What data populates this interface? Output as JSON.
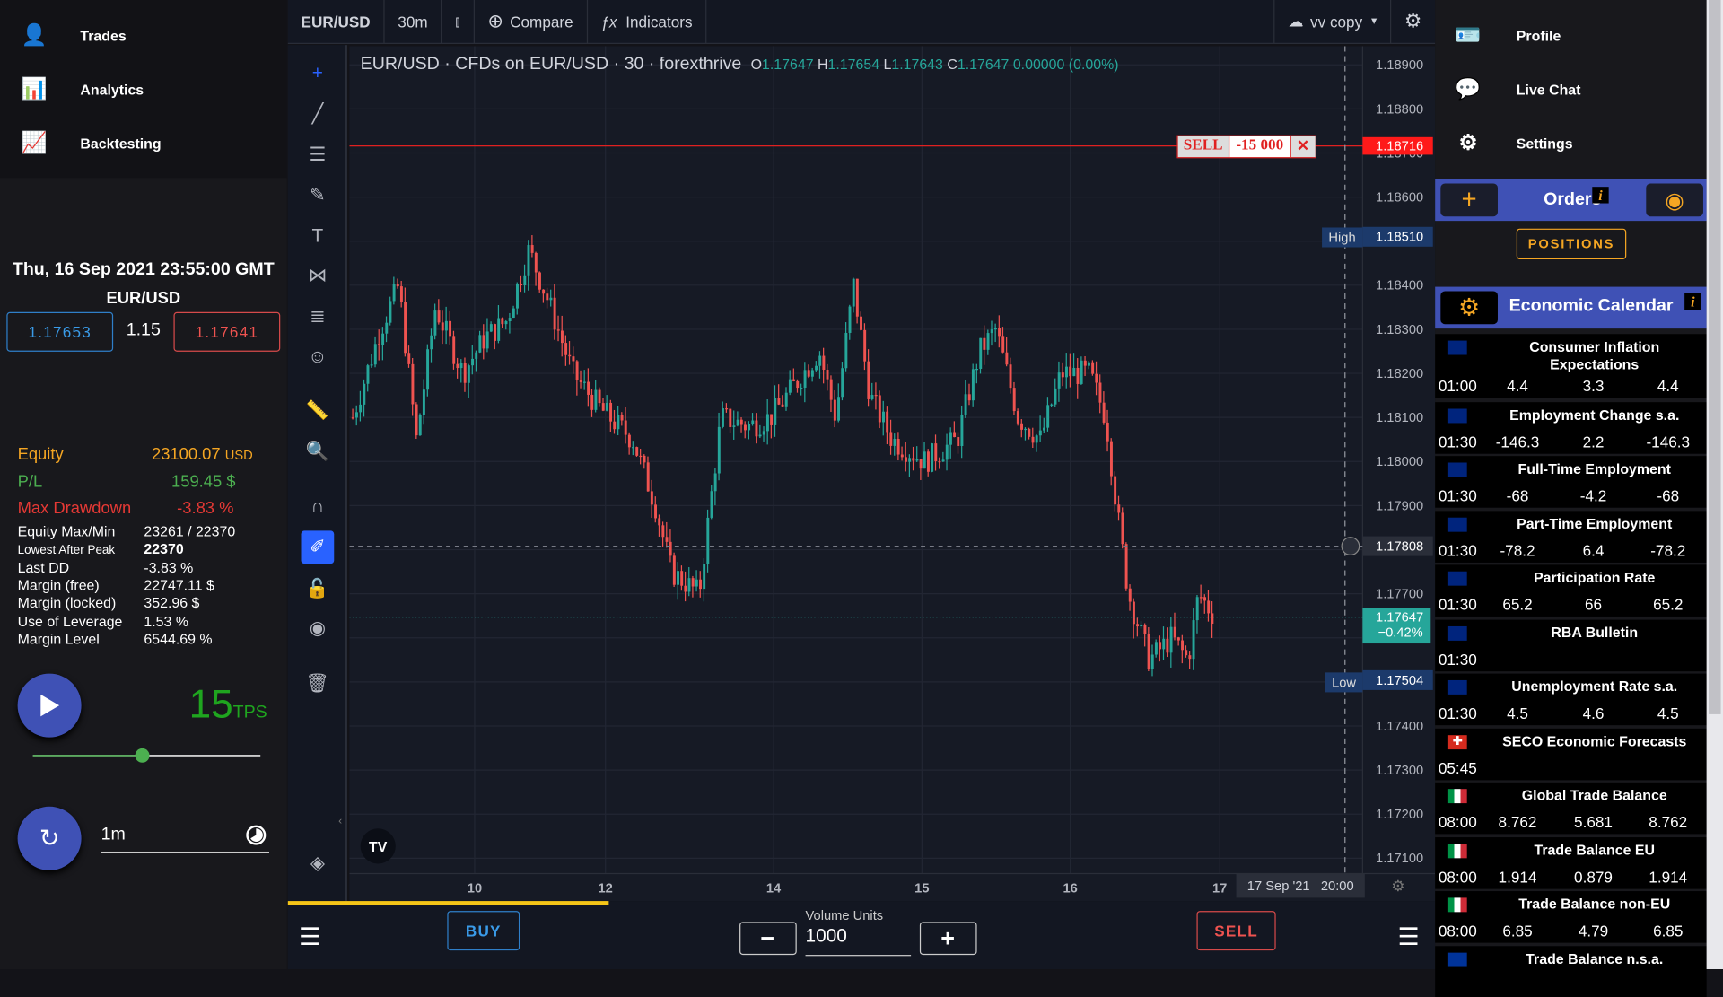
{
  "nav_left": [
    {
      "label": "Trades",
      "icon": "user-trades-icon"
    },
    {
      "label": "Analytics",
      "icon": "analytics-icon"
    },
    {
      "label": "Backtesting",
      "icon": "backtesting-icon"
    }
  ],
  "session": {
    "datetime": "Thu, 16 Sep 2021 23:55:00 GMT",
    "symbol": "EUR/USD",
    "bid": "1.17653",
    "spread": "1.15",
    "ask": "1.17641"
  },
  "stats": {
    "equity_label": "Equity",
    "equity_value": "23100.07",
    "equity_unit": "USD",
    "pl_label": "P/L",
    "pl_value": "159.45 $",
    "mdd_label": "Max Drawdown",
    "mdd_value": "-3.83 %",
    "rows": [
      {
        "label": "Equity Max/Min",
        "value": "23261 / 22370"
      },
      {
        "label": "Lowest After Peak",
        "value": "22370"
      },
      {
        "label": "Last DD",
        "value": "-3.83 %"
      },
      {
        "label": "Margin (free)",
        "value": "22747.11 $"
      },
      {
        "label": "Margin (locked)",
        "value": "352.96 $"
      },
      {
        "label": "Use of Leverage",
        "value": "1.53 %"
      },
      {
        "label": "Margin Level",
        "value": "6544.69 %"
      }
    ]
  },
  "playback": {
    "tps_value": "15",
    "tps_unit": "TPS",
    "speed_slider_fraction": 0.48,
    "interval_value": "1m"
  },
  "toolbar": {
    "symbol": "EUR/USD",
    "interval": "30m",
    "compare": "Compare",
    "indicators": "Indicators",
    "layout_name": "vv copy"
  },
  "legend": {
    "symbol": "EUR/USD",
    "desc": "· CFDs on EUR/USD",
    "interval": "· 30",
    "source": "· forexthrive",
    "o_label": "O",
    "o": "1.17647",
    "h_label": "H",
    "h": "1.17654",
    "l_label": "L",
    "l": "1.17643",
    "c_label": "C",
    "c": "1.17647",
    "change": "0.00000 (0.00%)"
  },
  "chart_data": {
    "type": "candlestick",
    "symbol": "EUR/USD",
    "ylim": [
      1.171,
      1.189
    ],
    "y_ticks": [
      "1.18900",
      "1.18800",
      "1.18700",
      "1.18600",
      "1.18500",
      "1.18400",
      "1.18300",
      "1.18200",
      "1.18100",
      "1.18000",
      "1.17900",
      "1.17800",
      "1.17700",
      "1.17600",
      "1.17500",
      "1.17400",
      "1.17300",
      "1.17200",
      "1.17100"
    ],
    "x_ticks": [
      "10",
      "12",
      "14",
      "15",
      "16",
      "17"
    ],
    "price_path": [
      [
        8.12,
        1.181
      ],
      [
        8.54,
        1.183
      ],
      [
        8.82,
        1.184
      ],
      [
        9.09,
        1.1805
      ],
      [
        9.38,
        1.1835
      ],
      [
        9.8,
        1.182
      ],
      [
        10.13,
        1.1828
      ],
      [
        10.47,
        1.1832
      ],
      [
        10.81,
        1.1848
      ],
      [
        11.14,
        1.1835
      ],
      [
        11.48,
        1.182
      ],
      [
        11.9,
        1.1812
      ],
      [
        12.31,
        1.1805
      ],
      [
        12.58,
        1.179
      ],
      [
        12.77,
        1.1775
      ],
      [
        13.1,
        1.177
      ],
      [
        13.36,
        1.181
      ],
      [
        13.69,
        1.1808
      ],
      [
        13.95,
        1.181
      ],
      [
        14.3,
        1.1825
      ],
      [
        14.41,
        1.181
      ],
      [
        14.53,
        1.184
      ],
      [
        14.64,
        1.1815
      ],
      [
        14.79,
        1.1805
      ],
      [
        15.01,
        1.18
      ],
      [
        15.23,
        1.1805
      ],
      [
        15.38,
        1.1825
      ],
      [
        15.49,
        1.183
      ],
      [
        15.64,
        1.181
      ],
      [
        15.79,
        1.1805
      ],
      [
        15.93,
        1.182
      ],
      [
        16.12,
        1.182
      ],
      [
        16.23,
        1.181
      ],
      [
        16.3,
        1.179
      ],
      [
        16.38,
        1.177
      ],
      [
        16.52,
        1.1755
      ],
      [
        16.67,
        1.176
      ],
      [
        16.78,
        1.1755
      ],
      [
        16.85,
        1.177
      ],
      [
        16.96,
        1.17647
      ]
    ],
    "order_line": {
      "side": "SELL",
      "qty": "-15 000",
      "price": "1.18716"
    },
    "high": {
      "label": "High",
      "price": "1.18510"
    },
    "low": {
      "label": "Low",
      "price": "1.17504"
    },
    "crosshair_price": "1.17808",
    "last_price": "1.17647",
    "last_change": "−0.42%",
    "crosshair_time": "17 Sep '21   20:00",
    "colors": {
      "up": "#26a69a",
      "down": "#ef5350"
    }
  },
  "bottom": {
    "buy": "BUY",
    "sell": "SELL",
    "volume_label": "Volume Units",
    "volume_value": "1000",
    "progress_fraction": 0.28
  },
  "nav_right": [
    {
      "label": "Profile",
      "icon": "profile-card-icon"
    },
    {
      "label": "Live Chat",
      "icon": "chat-icon"
    },
    {
      "label": "Settings",
      "icon": "gear-icon"
    }
  ],
  "orders": {
    "title": "Orders",
    "positions": "POSITIONS"
  },
  "calendar": {
    "title": "Economic Calendar",
    "events": [
      {
        "flag": "AU",
        "title": "Consumer Inflation Expectations",
        "time": "01:00",
        "actual": "4.4",
        "forecast": "3.3",
        "previous": "4.4"
      },
      {
        "flag": "AU",
        "title": "Employment Change s.a.",
        "time": "01:30",
        "actual": "-146.3",
        "forecast": "2.2",
        "previous": "-146.3"
      },
      {
        "flag": "AU",
        "title": "Full-Time Employment",
        "time": "01:30",
        "actual": "-68",
        "forecast": "-4.2",
        "previous": "-68"
      },
      {
        "flag": "AU",
        "title": "Part-Time Employment",
        "time": "01:30",
        "actual": "-78.2",
        "forecast": "6.4",
        "previous": "-78.2"
      },
      {
        "flag": "AU",
        "title": "Participation Rate",
        "time": "01:30",
        "actual": "65.2",
        "forecast": "66",
        "previous": "65.2"
      },
      {
        "flag": "AU",
        "title": "RBA Bulletin",
        "time": "01:30",
        "actual": "",
        "forecast": "",
        "previous": ""
      },
      {
        "flag": "AU",
        "title": "Unemployment Rate s.a.",
        "time": "01:30",
        "actual": "4.5",
        "forecast": "4.6",
        "previous": "4.5"
      },
      {
        "flag": "CH",
        "title": "SECO Economic Forecasts",
        "time": "05:45",
        "actual": "",
        "forecast": "",
        "previous": ""
      },
      {
        "flag": "IT",
        "title": "Global Trade Balance",
        "time": "08:00",
        "actual": "8.762",
        "forecast": "5.681",
        "previous": "8.762"
      },
      {
        "flag": "IT",
        "title": "Trade Balance EU",
        "time": "08:00",
        "actual": "1.914",
        "forecast": "0.879",
        "previous": "1.914"
      },
      {
        "flag": "IT",
        "title": "Trade Balance non-EU",
        "time": "08:00",
        "actual": "6.85",
        "forecast": "4.79",
        "previous": "6.85"
      },
      {
        "flag": "EU",
        "title": "Trade Balance n.s.a.",
        "time": "",
        "actual": "",
        "forecast": "",
        "previous": ""
      }
    ]
  }
}
